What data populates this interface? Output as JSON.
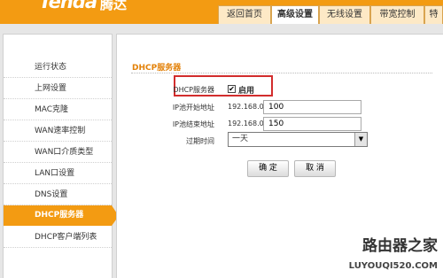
{
  "header": {
    "logo": "Tenda",
    "logo_cn": "腾达",
    "tabs": [
      {
        "label": "返回首页",
        "active": false
      },
      {
        "label": "高级设置",
        "active": true
      },
      {
        "label": "无线设置",
        "active": false
      },
      {
        "label": "带宽控制",
        "active": false
      },
      {
        "label": "特",
        "active": false
      }
    ]
  },
  "sidebar": {
    "items": [
      {
        "label": "运行状态",
        "active": false
      },
      {
        "label": "上网设置",
        "active": false
      },
      {
        "label": "MAC克隆",
        "active": false
      },
      {
        "label": "WAN速率控制",
        "active": false
      },
      {
        "label": "WAN口介质类型",
        "active": false
      },
      {
        "label": "LAN口设置",
        "active": false
      },
      {
        "label": "DNS设置",
        "active": false
      },
      {
        "label": "DHCP服务器",
        "active": true
      },
      {
        "label": "DHCP客户端列表",
        "active": false
      }
    ]
  },
  "main": {
    "section_title": "DHCP服务器",
    "dhcp_server": {
      "label": "DHCP服务器",
      "checked": true,
      "checkbox_mark": "✔",
      "enable_label": "启用"
    },
    "start_ip": {
      "label": "IP池开始地址",
      "prefix": "192.168.0.",
      "value": "100"
    },
    "end_ip": {
      "label": "IP池结束地址",
      "prefix": "192.168.0.",
      "value": "150"
    },
    "lease_time": {
      "label": "过期时间",
      "value": "一天",
      "arrow": "▼"
    },
    "confirm_button": "确 定",
    "cancel_button": "取 消"
  },
  "watermark": {
    "cn": "路由器之家",
    "url": "LUYOUQI520.COM"
  },
  "colors": {
    "brand_orange": "#f39b12",
    "highlight_red": "#d22d2d",
    "section_title": "#e38108"
  }
}
